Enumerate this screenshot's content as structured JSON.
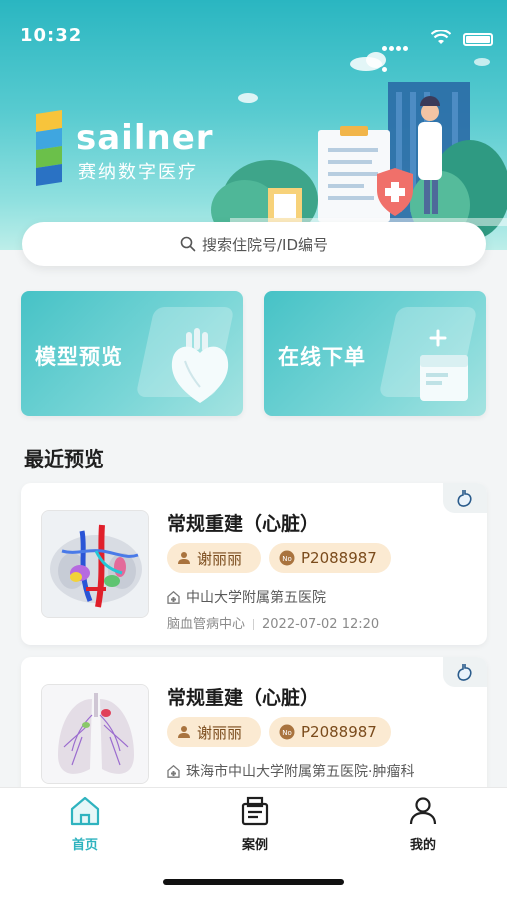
{
  "status_bar": {
    "time": "10:32"
  },
  "brand": {
    "name": "sailner",
    "subtitle": "赛纳数字医疗"
  },
  "search": {
    "placeholder": "搜索住院号/ID编号"
  },
  "actions": [
    {
      "label": "模型预览",
      "icon": "heart-model-icon"
    },
    {
      "label": "在线下单",
      "icon": "order-box-icon"
    }
  ],
  "recent": {
    "title": "最近预览",
    "items": [
      {
        "title": "常规重建（心脏）",
        "patient": "谢丽丽",
        "id": "P2088987",
        "hospital": "中山大学附属第五医院",
        "department": "脑血管病中心",
        "datetime": "2022-07-02 12:20",
        "tag_icon": "stomach-icon"
      },
      {
        "title": "常规重建（心脏）",
        "patient": "谢丽丽",
        "id": "P2088987",
        "hospital": "珠海市中山大学附属第五医院·肿瘤科",
        "tag_icon": "stomach-icon"
      }
    ]
  },
  "tabbar": {
    "items": [
      {
        "label": "首页",
        "icon": "home-icon",
        "active": true
      },
      {
        "label": "案例",
        "icon": "cases-icon",
        "active": false
      },
      {
        "label": "我的",
        "icon": "profile-icon",
        "active": false
      }
    ]
  },
  "colors": {
    "accent": "#2fb3bf",
    "chip_bg": "#fbead2",
    "chip_text": "#7a4b1c"
  }
}
